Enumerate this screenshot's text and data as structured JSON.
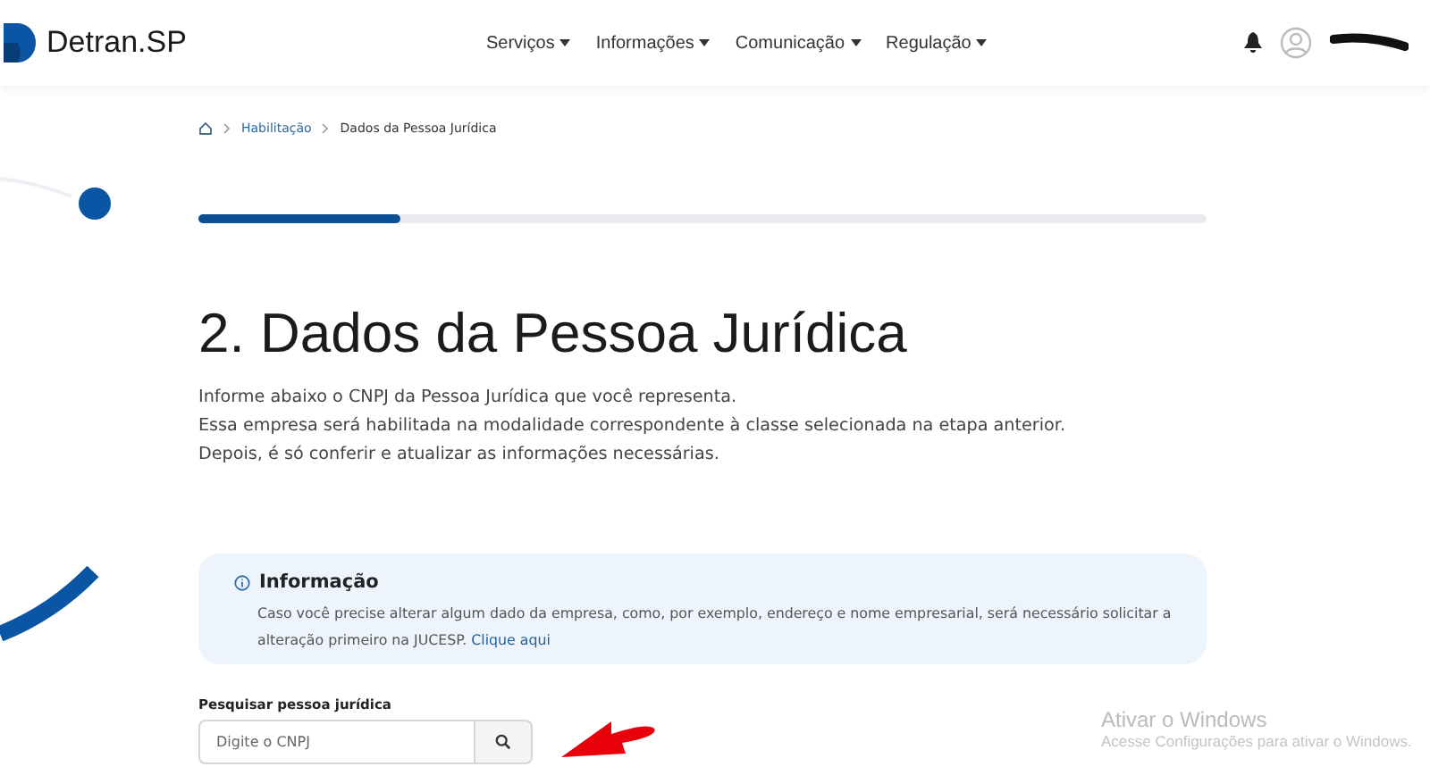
{
  "header": {
    "logo": "Detran",
    "logo_suffix": ".SP",
    "nav": [
      {
        "label": "Serviços"
      },
      {
        "label": "Informações"
      },
      {
        "label": "Comunicação"
      },
      {
        "label": "Regulação"
      }
    ]
  },
  "breadcrumb": [
    {
      "label": "Habilitação",
      "kind": "link"
    },
    {
      "label": "Dados da Pessoa Jurídica",
      "kind": "current"
    }
  ],
  "progress": {
    "level": 0.2
  },
  "title": "2. Dados da Pessoa Jurídica",
  "intro": [
    "Informe abaixo o CNPJ da Pessoa Jurídica que você representa.",
    "Essa empresa será habilitada na modalidade correspondente à classe selecionada na etapa anterior.",
    "Depois, é só conferir e atualizar as informações necessárias."
  ],
  "info": {
    "title": "Informação",
    "text": "Caso você precise alterar algum dado da empresa, como, por exemplo, endereço e nome empresarial, será necessário solicitar a alteração primeiro na JUCESP.",
    "link": "Clique aqui"
  },
  "search": {
    "label": "Pesquisar pessoa jurídica",
    "placeholder": "Digite o CNPJ"
  },
  "windows_notice": {
    "title": "Ativar o Windows",
    "text": "Acesse Configurações para ativar o Windows."
  }
}
